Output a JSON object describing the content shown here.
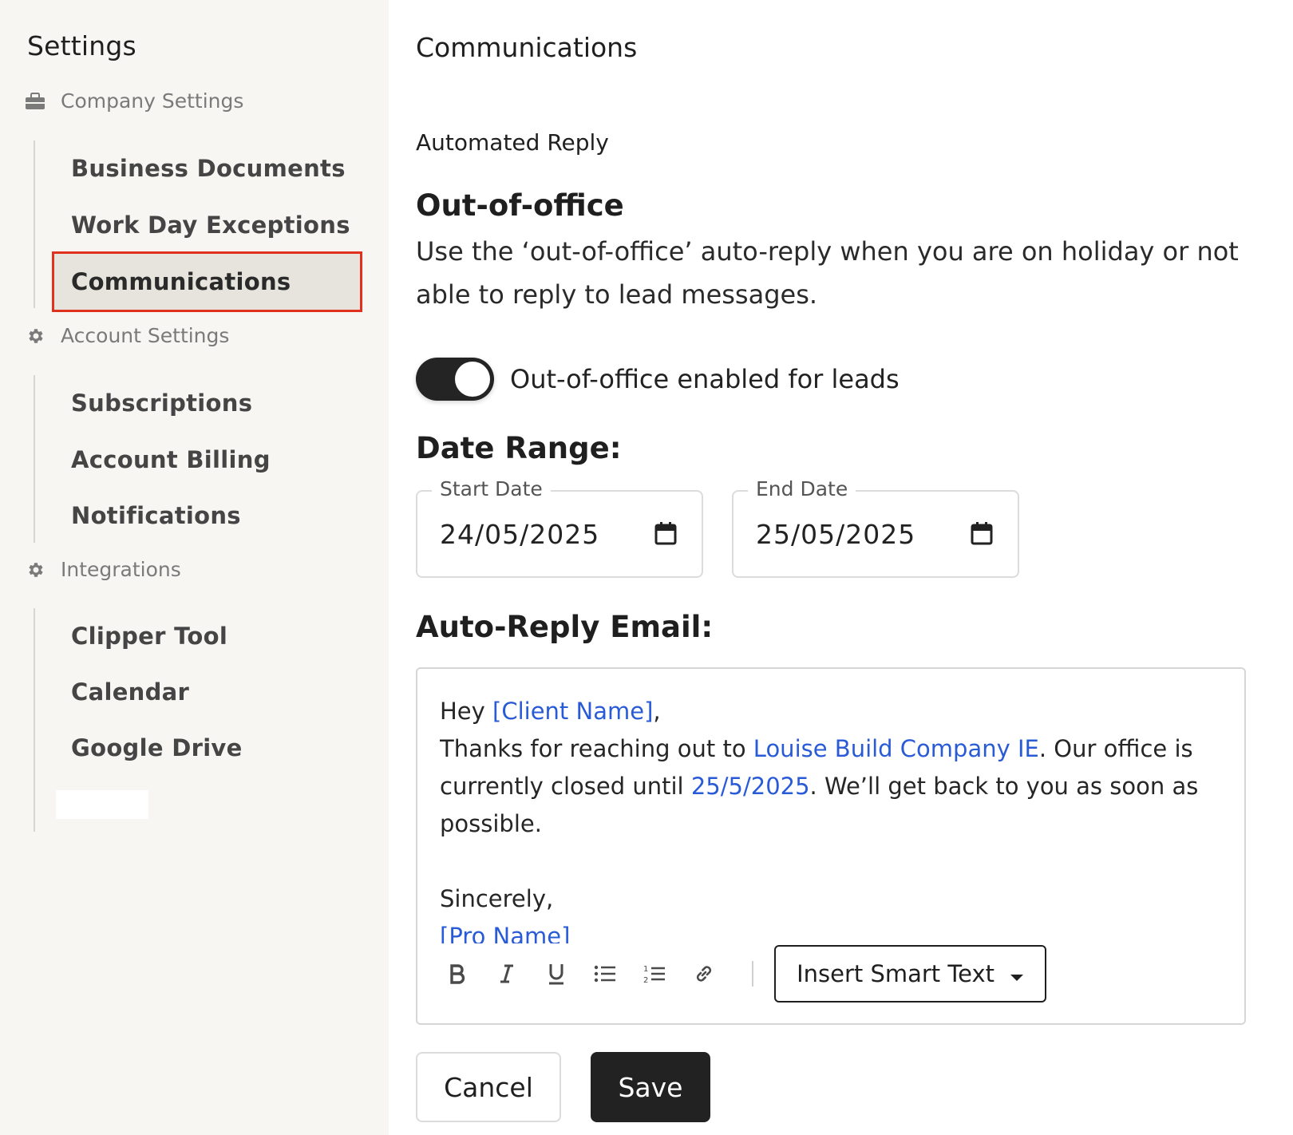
{
  "sidebar": {
    "title": "Settings",
    "groups": [
      {
        "label": "Company Settings",
        "icon": "briefcase-icon",
        "items": [
          "Business Documents",
          "Work Day Exceptions",
          "Communications"
        ]
      },
      {
        "label": "Account Settings",
        "icon": "gear-icon",
        "items": [
          "Subscriptions",
          "Account Billing",
          "Notifications"
        ]
      },
      {
        "label": "Integrations",
        "icon": "gear-icon",
        "items": [
          "Clipper Tool",
          "Calendar",
          "Google Drive"
        ]
      }
    ],
    "active_item": "Communications"
  },
  "main": {
    "page_title": "Communications",
    "section_title": "Automated Reply",
    "ooo_heading": "Out-of-office",
    "ooo_description": "Use the ‘out-of-office’ auto-reply when you are on holiday or not able to reply to lead messages.",
    "toggle": {
      "label": "Out-of-office enabled for leads",
      "enabled": true
    },
    "date_range_label": "Date Range:",
    "start_date": {
      "legend": "Start Date",
      "value": "24/05/2025",
      "icon": "calendar-icon"
    },
    "end_date": {
      "legend": "End Date",
      "value": "25/05/2025",
      "icon": "calendar-icon"
    },
    "auto_reply_label": "Auto-Reply Email:",
    "email": {
      "greeting": "Hey ",
      "client_token": "[Client Name]",
      "greeting_end": ",",
      "line2_a": "Thanks for reaching out to ",
      "company_token": "Louise Build Company IE",
      "line2_b": ". Our office is currently closed until ",
      "date_token": "25/5/2025",
      "line2_c": ". We’ll get back to you as soon as possible.",
      "signoff": "Sincerely,",
      "pro_token": "[Pro Name]"
    },
    "toolbar": {
      "buttons": [
        "bold-icon",
        "italic-icon",
        "underline-icon",
        "bullet-list-icon",
        "numbered-list-icon",
        "link-icon"
      ],
      "smart_text_label": "Insert Smart Text"
    },
    "cancel_label": "Cancel",
    "save_label": "Save"
  },
  "colors": {
    "sidebar_bg": "#f7f6f3",
    "active_bg": "#e6e4dd",
    "active_outline": "#e0301e",
    "token_blue": "#2a5bd7",
    "dark": "#222222"
  }
}
